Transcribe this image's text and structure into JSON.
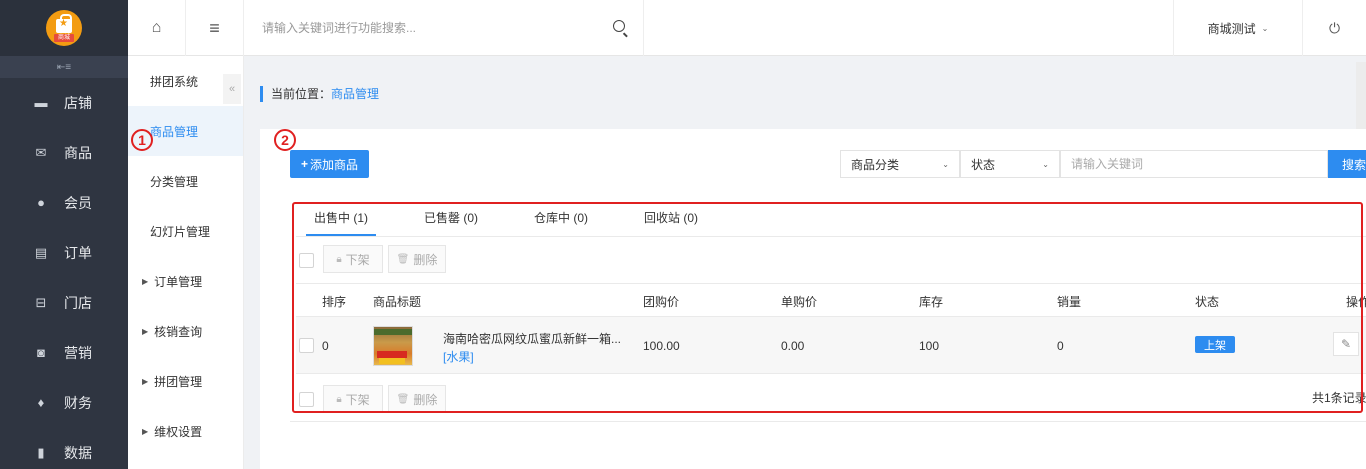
{
  "sidebar": {
    "logo_text": "商城",
    "items": [
      {
        "label": "店铺",
        "icon": "store-icon"
      },
      {
        "label": "商品",
        "icon": "goods-icon"
      },
      {
        "label": "会员",
        "icon": "member-icon"
      },
      {
        "label": "订单",
        "icon": "order-icon"
      },
      {
        "label": "门店",
        "icon": "shop-icon"
      },
      {
        "label": "营销",
        "icon": "gift-icon"
      },
      {
        "label": "财务",
        "icon": "money-bag-icon"
      },
      {
        "label": "数据",
        "icon": "bar-chart-icon"
      }
    ]
  },
  "subnav": {
    "items": [
      {
        "label": "拼团系统",
        "active": false,
        "expandable": false
      },
      {
        "label": "商品管理",
        "active": true,
        "expandable": false
      },
      {
        "label": "分类管理",
        "active": false,
        "expandable": false
      },
      {
        "label": "幻灯片管理",
        "active": false,
        "expandable": false
      },
      {
        "label": "订单管理",
        "active": false,
        "expandable": true
      },
      {
        "label": "核销查询",
        "active": false,
        "expandable": true
      },
      {
        "label": "拼团管理",
        "active": false,
        "expandable": true
      },
      {
        "label": "维权设置",
        "active": false,
        "expandable": true
      }
    ]
  },
  "topbar": {
    "search_placeholder": "请输入关键词进行功能搜索...",
    "store_name": "商城测试"
  },
  "breadcrumb": {
    "prefix": "当前位置：",
    "current": "商品管理"
  },
  "toolbar": {
    "add_label": "添加商品",
    "category_filter": "商品分类",
    "status_filter": "状态",
    "keyword_placeholder": "请输入关键词",
    "search_label": "搜索"
  },
  "tabs": [
    {
      "label": "出售中 (1)",
      "active": true
    },
    {
      "label": "已售罄 (0)",
      "active": false
    },
    {
      "label": "仓库中 (0)",
      "active": false
    },
    {
      "label": "回收站 (0)",
      "active": false
    }
  ],
  "bulk": {
    "offshelf_label": "下架",
    "delete_label": "删除"
  },
  "table": {
    "columns": [
      "排序",
      "商品标题",
      "团购价",
      "单购价",
      "库存",
      "销量",
      "状态",
      "操作"
    ],
    "rows": [
      {
        "sort": "0",
        "title": "海南哈密瓜网纹瓜蜜瓜新鲜一箱...",
        "category": "[水果]",
        "group_price": "100.00",
        "single_price": "0.00",
        "stock": "100",
        "sales": "0",
        "status": "上架"
      }
    ]
  },
  "footer": {
    "total": "共1条记录"
  },
  "annotations": {
    "one": "1",
    "two": "2"
  },
  "colors": {
    "accent": "#2d8cf0",
    "sidebar": "#2f3541",
    "annotation": "#e02020"
  }
}
